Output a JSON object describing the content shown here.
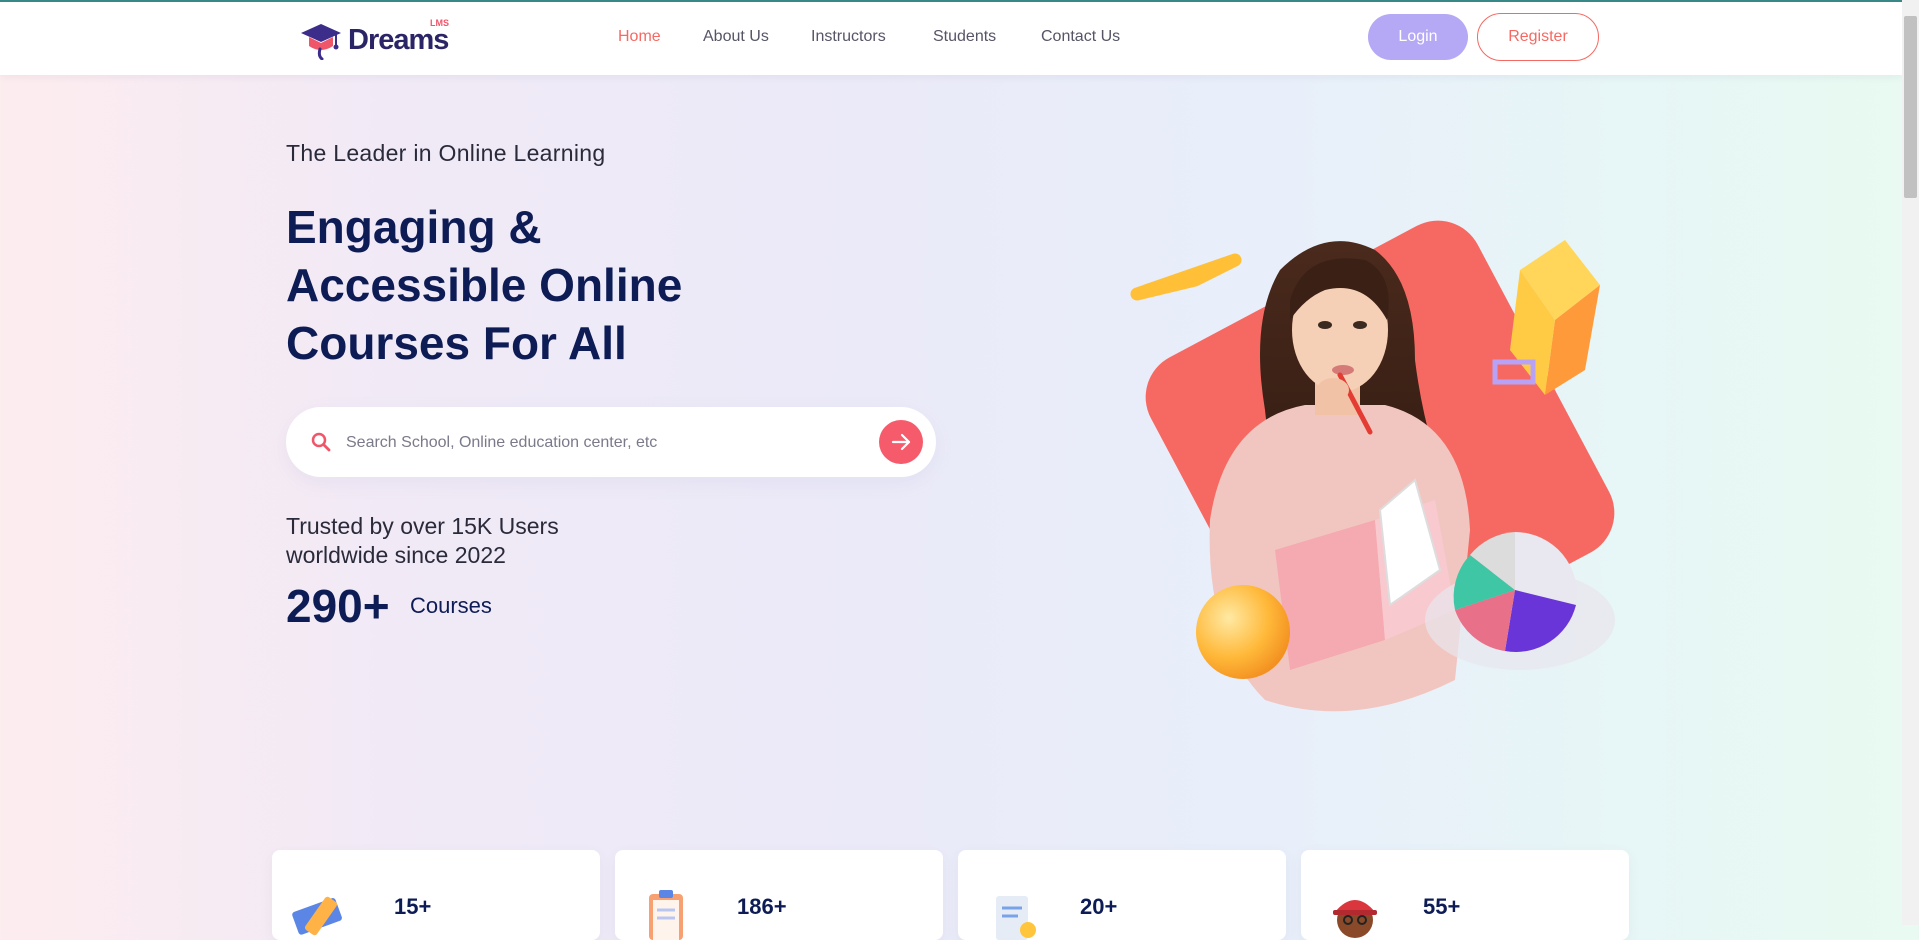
{
  "brand": {
    "name": "Dreams",
    "sup": "LMS"
  },
  "nav": {
    "items": [
      {
        "label": "Home",
        "active": true
      },
      {
        "label": "About Us",
        "active": false
      },
      {
        "label": "Instructors",
        "active": false
      },
      {
        "label": "Students",
        "active": false
      },
      {
        "label": "Contact Us",
        "active": false
      }
    ],
    "login_label": "Login",
    "register_label": "Register"
  },
  "hero": {
    "tagline": "The Leader in Online Learning",
    "headline_lines": [
      "Engaging &",
      "Accessible Online",
      "Courses For All"
    ],
    "search": {
      "placeholder": "Search School, Online education center, etc",
      "value": ""
    },
    "trusted_lines": [
      "Trusted by over 15K Users",
      "worldwide since 2022"
    ],
    "stat": {
      "value": "290+",
      "label": "Courses"
    }
  },
  "stats_cards": [
    {
      "value": "15+",
      "icon": "pencil-ruler-icon"
    },
    {
      "value": "186+",
      "icon": "clipboard-icon"
    },
    {
      "value": "20+",
      "icon": "certificate-icon"
    },
    {
      "value": "55+",
      "icon": "instructor-avatar-icon"
    }
  ],
  "colors": {
    "accent": "#f66962",
    "navy": "#0e1c56",
    "login_bg": "#b5a8f5",
    "search_button": "#f65b6c"
  }
}
